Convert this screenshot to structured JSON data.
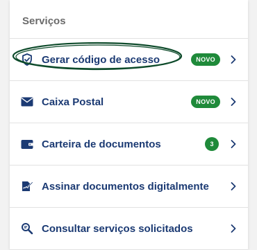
{
  "section": {
    "title": "Serviços"
  },
  "items": [
    {
      "label": "Gerar código de acesso",
      "icon": "shield-check-icon",
      "badge": "NOVO"
    },
    {
      "label": "Caixa Postal",
      "icon": "envelope-icon",
      "badge": "NOVO"
    },
    {
      "label": "Carteira de documentos",
      "icon": "wallet-icon",
      "badge": "3"
    },
    {
      "label": "Assinar documentos digitalmente",
      "icon": "sign-document-icon"
    },
    {
      "label": "Consultar serviços solicitados",
      "icon": "search-list-icon"
    }
  ],
  "colors": {
    "accent": "#1b3a73",
    "badge": "#1f8a3a"
  }
}
